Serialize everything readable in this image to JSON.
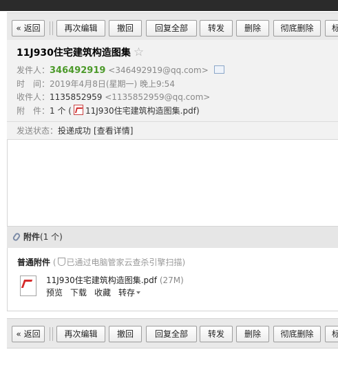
{
  "toolbar": {
    "back": "« 返回",
    "reedit": "再次编辑",
    "recall": "撤回",
    "reply_all": "回复全部",
    "forward": "转发",
    "delete": "删除",
    "delete_permanently": "彻底删除",
    "more_truncated": "标"
  },
  "mail": {
    "subject": "11J930住宅建筑构造图集",
    "star": "☆",
    "sender_label": "发件人：",
    "sender_name": "346492919",
    "sender_email": "<346492919@qq.com>",
    "time_label": "时　间：",
    "time_value": "2019年4月8日(星期一) 晚上9:54",
    "recipient_label": "收件人：",
    "recipient_name": "1135852959",
    "recipient_email": "<1135852959@qq.com>",
    "attachment_label": "附　件：",
    "attachment_count": "1 个 (",
    "attachment_inline_name": "11J930住宅建筑构造图集.pdf",
    "attachment_close": ")",
    "status_label": "发送状态：",
    "status_value": "投递成功",
    "status_link": "[查看详情]"
  },
  "attachments": {
    "title": "附件",
    "count": "(1 个)",
    "section_label": "普通附件",
    "scan_prefix": "(",
    "scan_text": "已通过电脑管家云查杀引擎扫描)",
    "file_name": "11J930住宅建筑构造图集.pdf",
    "file_size": "(27M)",
    "actions": {
      "preview": "预览",
      "download": "下载",
      "collect": "收藏",
      "save_to": "转存"
    }
  },
  "icons": {
    "vcard": "contact-card-icon",
    "pdf": "pdf-icon",
    "clip": "paperclip-icon",
    "shield": "shield-icon",
    "dropdown": "chevron-down-icon"
  }
}
